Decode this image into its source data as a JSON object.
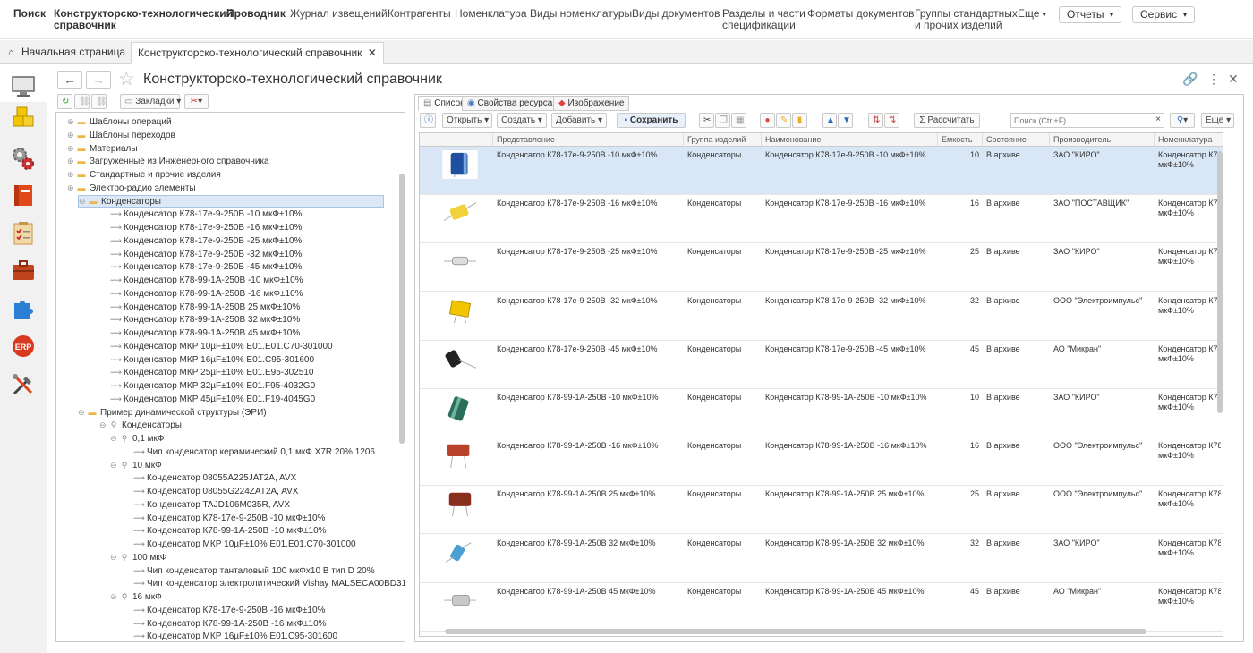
{
  "topnav": {
    "search": "Поиск",
    "section_line1": "Конструкторско-технологический",
    "section_line2": "справочник",
    "explorer": "Проводник",
    "items": [
      "Журнал извещений",
      "Контрагенты",
      "Номенклатура",
      "Виды номенклатуры",
      "Виды документов"
    ],
    "spec_line1": "Разделы и части",
    "spec_line2": "спецификации",
    "formats": "Форматы документов",
    "groups_line1": "Группы стандартных",
    "groups_line2": "и прочих изделий",
    "more": "Еще",
    "reports": "Отчеты",
    "service": "Сервис"
  },
  "tabs": {
    "home": "Начальная страница",
    "current": "Конструкторско-технологический справочник"
  },
  "page": {
    "title": "Конструкторско-технологический справочник",
    "bookmarks": "Закладки"
  },
  "tree": {
    "nodes": [
      {
        "label": "Шаблоны операций",
        "level": 1,
        "kind": "folder"
      },
      {
        "label": "Шаблоны переходов",
        "level": 1,
        "kind": "folder"
      },
      {
        "label": "Материалы",
        "level": 1,
        "kind": "folder"
      },
      {
        "label": "Загруженные из Инженерного справочника",
        "level": 1,
        "kind": "folder"
      },
      {
        "label": "Стандартные и прочие изделия",
        "level": 1,
        "kind": "folder"
      },
      {
        "label": "Электро-радио элементы",
        "level": 1,
        "kind": "folder"
      },
      {
        "label": "Конденсаторы",
        "level": 2,
        "kind": "folder",
        "selected": true
      },
      {
        "label": "Конденсатор К78-17е-9-250В -10 мкФ±10%",
        "level": 3,
        "kind": "item"
      },
      {
        "label": "Конденсатор К78-17е-9-250В -16 мкФ±10%",
        "level": 3,
        "kind": "item"
      },
      {
        "label": "Конденсатор К78-17е-9-250В -25 мкФ±10%",
        "level": 3,
        "kind": "item"
      },
      {
        "label": "Конденсатор К78-17е-9-250В -32 мкФ±10%",
        "level": 3,
        "kind": "item"
      },
      {
        "label": "Конденсатор К78-17е-9-250В -45 мкФ±10%",
        "level": 3,
        "kind": "item"
      },
      {
        "label": "Конденсатор К78-99-1А-250В -10 мкФ±10%",
        "level": 3,
        "kind": "item"
      },
      {
        "label": "Конденсатор К78-99-1А-250В -16 мкФ±10%",
        "level": 3,
        "kind": "item"
      },
      {
        "label": "Конденсатор К78-99-1А-250В 25 мкФ±10%",
        "level": 3,
        "kind": "item"
      },
      {
        "label": "Конденсатор К78-99-1А-250В 32 мкФ±10%",
        "level": 3,
        "kind": "item"
      },
      {
        "label": "Конденсатор К78-99-1А-250В 45 мкФ±10%",
        "level": 3,
        "kind": "item"
      },
      {
        "label": "Конденсатор МКР 10µF±10% E01.E01.C70-301000",
        "level": 3,
        "kind": "item"
      },
      {
        "label": "Конденсатор МКР 16µF±10% E01.C95-301600",
        "level": 3,
        "kind": "item"
      },
      {
        "label": "Конденсатор МКР 25µF±10% E01.E95-302510",
        "level": 3,
        "kind": "item"
      },
      {
        "label": "Конденсатор МКР 32µF±10% E01.F95-4032G0",
        "level": 3,
        "kind": "item"
      },
      {
        "label": "Конденсатор МКР 45µF±10% E01.F19-4045G0",
        "level": 3,
        "kind": "item"
      },
      {
        "label": "Пример динамической структуры (ЭРИ)",
        "level": 2,
        "kind": "folder"
      },
      {
        "label": "Конденсаторы",
        "level": 3,
        "kind": "query"
      },
      {
        "label": "0,1 мкФ",
        "level": 4,
        "kind": "query"
      },
      {
        "label": "Чип конденсатор керамический 0,1 мкФ X7R 20% 1206",
        "level": 5,
        "kind": "item"
      },
      {
        "label": "10 мкФ",
        "level": 4,
        "kind": "query"
      },
      {
        "label": "Конденсатор 08055A225JAT2A, AVX",
        "level": 5,
        "kind": "item"
      },
      {
        "label": "Конденсатор 08055G224ZAT2A, AVX",
        "level": 5,
        "kind": "item"
      },
      {
        "label": "Конденсатор TAJD106M035R, AVX",
        "level": 5,
        "kind": "item"
      },
      {
        "label": "Конденсатор К78-17е-9-250В -10 мкФ±10%",
        "level": 5,
        "kind": "item"
      },
      {
        "label": "Конденсатор К78-99-1А-250В -10 мкФ±10%",
        "level": 5,
        "kind": "item"
      },
      {
        "label": "Конденсатор МКР 10µF±10% E01.E01.C70-301000",
        "level": 5,
        "kind": "item"
      },
      {
        "label": "100 мкФ",
        "level": 4,
        "kind": "query"
      },
      {
        "label": "Чип конденсатор танталовый 100 мкФх10 В тип D 20%",
        "level": 5,
        "kind": "item"
      },
      {
        "label": "Чип конденсатор электролитический Vishay MALSECA00BD310DA...",
        "level": 5,
        "kind": "item"
      },
      {
        "label": "16 мкФ",
        "level": 4,
        "kind": "query"
      },
      {
        "label": "Конденсатор К78-17е-9-250В -16 мкФ±10%",
        "level": 5,
        "kind": "item"
      },
      {
        "label": "Конденсатор К78-99-1А-250В -16 мкФ±10%",
        "level": 5,
        "kind": "item"
      },
      {
        "label": "Конденсатор МКР 16µF±10% E01.C95-301600",
        "level": 5,
        "kind": "item"
      }
    ]
  },
  "rtabs": {
    "list": "Список",
    "props": "Свойства ресурса",
    "image": "Изображение"
  },
  "toolbar": {
    "open": "Открыть",
    "create": "Создать",
    "add": "Добавить",
    "save": "Сохранить",
    "calculate": "Рассчитать",
    "search_placeholder": "Поиск (Ctrl+F)",
    "more": "Еще"
  },
  "columns": {
    "repr": "Представление",
    "group": "Группа изделий",
    "name": "Наименование",
    "capacity": "Емкость",
    "state": "Состояние",
    "maker": "Производитель",
    "nomen": "Номенклатура"
  },
  "rows": [
    {
      "repr": "Конденсатор К78-17е-9-250В -10 мкФ±10%",
      "group": "Конденсаторы",
      "name": "Конденсатор К78-17е-9-250В -10 мкФ±10%",
      "capacity": "10",
      "state": "В архиве",
      "maker": "ЗАО \"КИРО\"",
      "nomen1": "Конденсатор К78",
      "nomen2": "мкФ±10%",
      "thumb": "blue-electrolytic"
    },
    {
      "repr": "Конденсатор К78-17е-9-250В -16 мкФ±10%",
      "group": "Конденсаторы",
      "name": "Конденсатор К78-17е-9-250В -16 мкФ±10%",
      "capacity": "16",
      "state": "В архиве",
      "maker": "ЗАО \"ПОСТАВЩИК\"",
      "nomen1": "Конденсатор К78-",
      "nomen2": "мкФ±10%",
      "thumb": "yellow-film"
    },
    {
      "repr": "Конденсатор К78-17е-9-250В -25 мкФ±10%",
      "group": "Конденсаторы",
      "name": "Конденсатор К78-17е-9-250В -25 мкФ±10%",
      "capacity": "25",
      "state": "В архиве",
      "maker": "ЗАО \"КИРО\"",
      "nomen1": "Конденсатор К78-",
      "nomen2": "мкФ±10%",
      "thumb": "white-axial"
    },
    {
      "repr": "Конденсатор К78-17е-9-250В -32 мкФ±10%",
      "group": "Конденсаторы",
      "name": "Конденсатор К78-17е-9-250В -32 мкФ±10%",
      "capacity": "32",
      "state": "В архиве",
      "maker": "ООО \"Электроимпульс\"",
      "nomen1": "Конденсатор К78-",
      "nomen2": "мкФ±10%",
      "thumb": "yellow-box"
    },
    {
      "repr": "Конденсатор К78-17е-9-250В -45 мкФ±10%",
      "group": "Конденсаторы",
      "name": "Конденсатор К78-17е-9-250В -45 мкФ±10%",
      "capacity": "45",
      "state": "В архиве",
      "maker": "АО \"Микран\"",
      "nomen1": "Конденсатор К78-",
      "nomen2": "мкФ±10%",
      "thumb": "black-electrolytic"
    },
    {
      "repr": "Конденсатор К78-99-1А-250В -10 мкФ±10%",
      "group": "Конденсаторы",
      "name": "Конденсатор К78-99-1А-250В -10 мкФ±10%",
      "capacity": "10",
      "state": "В архиве",
      "maker": "ЗАО \"КИРО\"",
      "nomen1": "Конденсатор К78-",
      "nomen2": "мкФ±10%",
      "thumb": "green-electrolytic"
    },
    {
      "repr": "Конденсатор К78-99-1А-250В -16 мкФ±10%",
      "group": "Конденсаторы",
      "name": "Конденсатор К78-99-1А-250В -16 мкФ±10%",
      "capacity": "16",
      "state": "В архиве",
      "maker": "ООО \"Электроимпульс\"",
      "nomen1": "Конденсатор К78-",
      "nomen2": "мкФ±10%",
      "thumb": "red-film"
    },
    {
      "repr": "Конденсатор К78-99-1А-250В 25 мкФ±10%",
      "group": "Конденсаторы",
      "name": "Конденсатор К78-99-1А-250В 25 мкФ±10%",
      "capacity": "25",
      "state": "В архиве",
      "maker": "ООО \"Электроимпульс\"",
      "nomen1": "Конденсатор К78-",
      "nomen2": "мкФ±10%",
      "thumb": "brown-film"
    },
    {
      "repr": "Конденсатор К78-99-1А-250В 32 мкФ±10%",
      "group": "Конденсаторы",
      "name": "Конденсатор К78-99-1А-250В 32 мкФ±10%",
      "capacity": "32",
      "state": "В архиве",
      "maker": "ЗАО \"КИРО\"",
      "nomen1": "Конденсатор К78-",
      "nomen2": "мкФ±10%",
      "thumb": "blue-axial"
    },
    {
      "repr": "Конденсатор К78-99-1А-250В 45 мкФ±10%",
      "group": "Конденсаторы",
      "name": "Конденсатор К78-99-1А-250В 45 мкФ±10%",
      "capacity": "45",
      "state": "В архиве",
      "maker": "АО \"Микран\"",
      "nomen1": "Конденсатор К78-",
      "nomen2": "мкФ±10%",
      "thumb": "gray-axial"
    }
  ]
}
